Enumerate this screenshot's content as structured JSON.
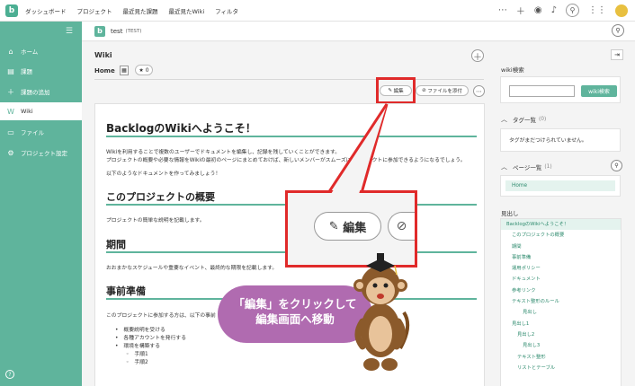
{
  "topbar": {
    "logo": "b",
    "nav": [
      "ダッシュボード",
      "プロジェクト",
      "最近見た課題",
      "最近見たWiki",
      "フィルタ"
    ],
    "icons": [
      "more-icon",
      "plus-icon",
      "eye-icon",
      "bell-icon",
      "search-icon",
      "apps-icon",
      "avatar"
    ]
  },
  "sidebar": {
    "items": [
      {
        "label": "ホーム",
        "icon": "home-icon"
      },
      {
        "label": "課題",
        "icon": "list-icon"
      },
      {
        "label": "課題の追加",
        "icon": "plus-icon"
      },
      {
        "label": "Wiki",
        "icon": "wiki-icon"
      },
      {
        "label": "ファイル",
        "icon": "file-icon"
      },
      {
        "label": "プロジェクト設定",
        "icon": "gear-icon"
      }
    ],
    "active": "Wiki",
    "help": "?"
  },
  "project": {
    "icon": "b",
    "name": "test",
    "key": "(TEST)"
  },
  "main": {
    "title": "Wiki",
    "page_name": "Home",
    "star_count": "0",
    "edit_label": "編集",
    "attach_label": "ファイルを添付"
  },
  "doc": {
    "h1": "BacklogのWikiへようこそ！",
    "intro1": "Wikiを利用することで複数のユーザーでドキュメントを編集し、記録を残していくことができます。",
    "intro2": "プロジェクトの概要や必要な情報をWikiの最初のページにまとめておけば、新しいメンバーがスムーズにプロジェクトに参加できるようになるでしょう。",
    "intro3": "以下のようなドキュメントを作ってみましょう！",
    "h2_overview": "このプロジェクトの概要",
    "p_overview": "プロジェクトの簡単な説明を記載します。",
    "h2_period": "期間",
    "p_period": "おおまかなスケジュールや重要なイベント、最終的な期限を記載します。",
    "h2_prep": "事前準備",
    "p_prep": "このプロジェクトに参加する方は、以下の事前",
    "list": [
      {
        "text": "概要説明を受ける",
        "level": 1
      },
      {
        "text": "各種アカウントを発行する",
        "level": 1
      },
      {
        "text": "環境を構築する",
        "level": 1
      },
      {
        "text": "手順1",
        "level": 2
      },
      {
        "text": "手順2",
        "level": 2
      }
    ]
  },
  "rpanel": {
    "search_label": "wiki検索",
    "search_button": "wiki検索",
    "search_placeholder": "",
    "tags_title": "タグ一覧",
    "tags_count": "(0)",
    "tags_empty": "タグがまだつけられていません。",
    "pages_title": "ページ一覧",
    "pages_count": "(1)",
    "pages": [
      "Home"
    ],
    "toc_title": "見出し",
    "toc": [
      {
        "text": "BacklogのWikiへようこそ！",
        "indent": 0
      },
      {
        "text": "このプロジェクトの概要",
        "indent": 1
      },
      {
        "text": "期間",
        "indent": 1
      },
      {
        "text": "事前準備",
        "indent": 1
      },
      {
        "text": "運用ポリシー",
        "indent": 1
      },
      {
        "text": "ドキュメント",
        "indent": 1
      },
      {
        "text": "参考リンク",
        "indent": 1
      },
      {
        "text": "テキスト整形のルール",
        "indent": 1
      },
      {
        "text": "見出し",
        "indent": 2
      },
      {
        "text": "見出し1",
        "indent": 1
      },
      {
        "text": "見出し2",
        "indent": 2
      },
      {
        "text": "見出し3",
        "indent": 3
      },
      {
        "text": "テキスト整形",
        "indent": 2
      },
      {
        "text": "リストとテーブル",
        "indent": 2
      }
    ]
  },
  "callout": {
    "zoom_edit_label": "編集",
    "caption_line1": "「編集」をクリックして",
    "caption_line2": "編集画面へ移動",
    "accent": "#e02a2a",
    "bubble_color": "#b06bb0"
  },
  "colors": {
    "brand": "#5fb49c"
  }
}
